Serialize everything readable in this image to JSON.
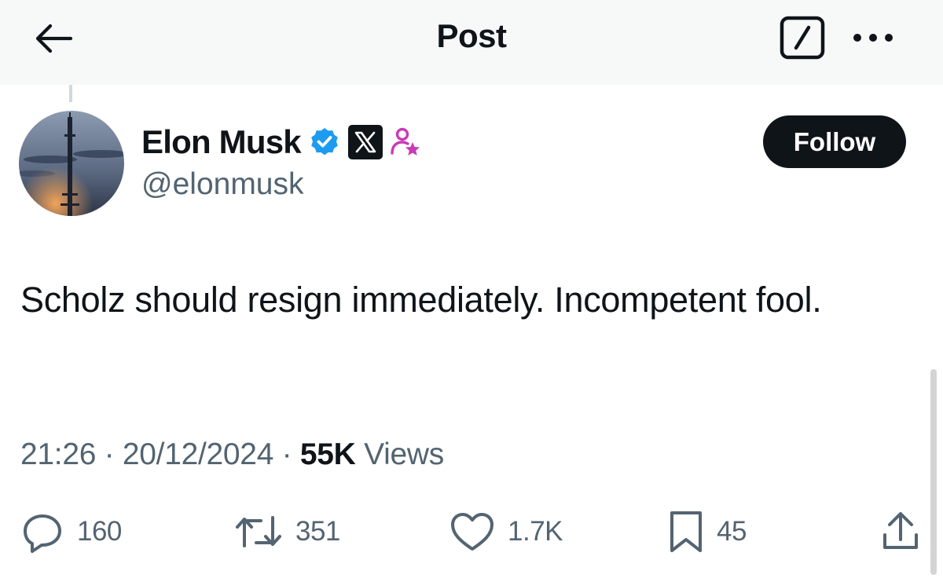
{
  "header": {
    "title": "Post",
    "back_icon": "arrow-left-icon",
    "compose_icon": "compose-icon",
    "more_icon": "more-dots-icon"
  },
  "author": {
    "name": "Elon Musk",
    "handle": "@elonmusk",
    "badges": [
      "verified-checkmark-icon",
      "x-affiliate-logo-icon",
      "subscriber-star-person-icon"
    ],
    "verified_color": "#1d9bf0",
    "subscriber_color": "#c93ab7",
    "follow_label": "Follow"
  },
  "post": {
    "text": "Scholz should resign immediately. Incompetent fool.",
    "time": "21:26",
    "date": "20/12/2024",
    "views_count": "55K",
    "views_label": "Views"
  },
  "actions": [
    {
      "icon": "reply-icon",
      "count": "160"
    },
    {
      "icon": "repost-icon",
      "count": "351"
    },
    {
      "icon": "like-heart-icon",
      "count": "1.7K"
    },
    {
      "icon": "bookmark-icon",
      "count": "45"
    },
    {
      "icon": "share-icon",
      "count": ""
    }
  ],
  "colors": {
    "text": "#0f1419",
    "secondary": "#536471",
    "header_bg": "#f7f9f9"
  }
}
